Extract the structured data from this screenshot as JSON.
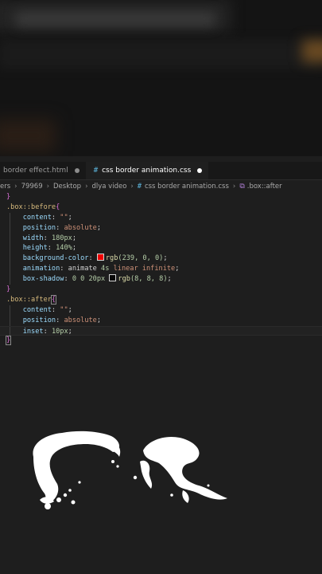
{
  "tabs": [
    {
      "label": "border effect.html",
      "modified": true,
      "active": false
    },
    {
      "label": "css border animation.css",
      "modified": true,
      "active": true
    }
  ],
  "breadcrumb": {
    "segments": [
      "ers",
      "79969",
      "Desktop",
      "dlya video",
      "css border animation.css",
      ".box::after"
    ]
  },
  "code": {
    "l1": "}",
    "l2_selector": ".box::before",
    "l2_brace": "{",
    "l3_prop": "content",
    "l3_val": "\"\"",
    "l4_prop": "position",
    "l4_val": "absolute",
    "l5_prop": "width",
    "l5_val": "180px",
    "l6_prop": "height",
    "l6_val": "140%",
    "l7_prop": "background-color",
    "l7_fn": "rgb",
    "l7_args": "(239, 0, 0)",
    "l8_prop": "animation",
    "l8_name": "animate",
    "l8_dur": "4s",
    "l8_timing": "linear",
    "l8_iter": "infinite",
    "l9_prop": "box-shadow",
    "l9_offsets": "0 0 20px",
    "l9_fn": "rgb",
    "l9_args": "(8, 8, 8)",
    "l10": "}",
    "l11_selector": ".box::after",
    "l11_brace": "{",
    "l12_prop": "content",
    "l12_val": "\"\"",
    "l13_prop": "position",
    "l13_val": "absolute",
    "l14_prop": "inset",
    "l14_val": "10px",
    "l15": "}"
  },
  "colors": {
    "swatch_red": "#ef0000",
    "swatch_dark": "#080808",
    "editor_bg": "#1e1e1e"
  }
}
